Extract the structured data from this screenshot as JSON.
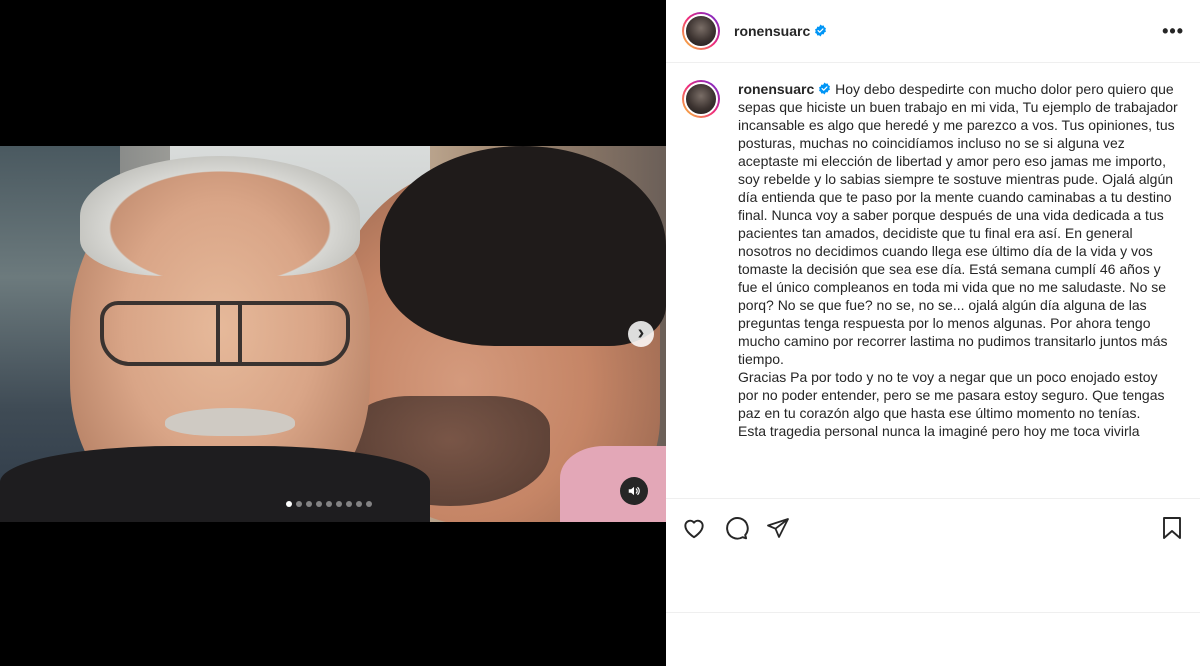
{
  "post": {
    "username": "ronensuarc",
    "verified": true,
    "more_label": "•••",
    "caption_paragraphs": [
      "Hoy debo despedirte con mucho dolor pero quiero que sepas que hiciste un buen trabajo en mi vida, Tu ejemplo de trabajador incansable es algo que heredé y me parezco a vos. Tus opiniones, tus posturas, muchas no coincidíamos incluso no se si alguna vez aceptaste mi elección de libertad y amor pero eso jamas me importo, soy rebelde y lo sabias siempre te sostuve mientras pude. Ojalá algún día entienda que te paso por la mente cuando caminabas a tu destino final. Nunca voy a saber porque después de una vida dedicada a tus pacientes tan amados, decidiste que tu final era así. En general nosotros no decidimos cuando llega ese último día de la vida y vos tomaste la decisión que sea ese día. Está semana cumplí 46 años y fue el único compleanos en toda mi vida que no me saludaste. No se porq? No se que fue? no se, no se... ojalá algún día alguna de las preguntas tenga respuesta por lo menos algunas. Por ahora tengo mucho camino por recorrer lastima no pudimos transitarlo juntos más tiempo.",
      "Gracias Pa por todo y no te voy a negar que un poco enojado estoy por no poder entender, pero se me pasara estoy seguro. Que tengas paz en tu corazón algo que hasta ese último momento no tenías.",
      "Esta tragedia personal nunca la imaginé pero hoy me toca vivirla"
    ]
  },
  "carousel": {
    "next_label": "›",
    "slide_count": 9,
    "active_index": 0
  },
  "colors": {
    "verified_blue": "#0095f6",
    "text": "#262626",
    "border": "#efefef"
  },
  "icons": {
    "like": "heart-icon",
    "comment": "comment-icon",
    "share": "paper-plane-icon",
    "save": "bookmark-icon",
    "mute": "speaker-icon"
  }
}
